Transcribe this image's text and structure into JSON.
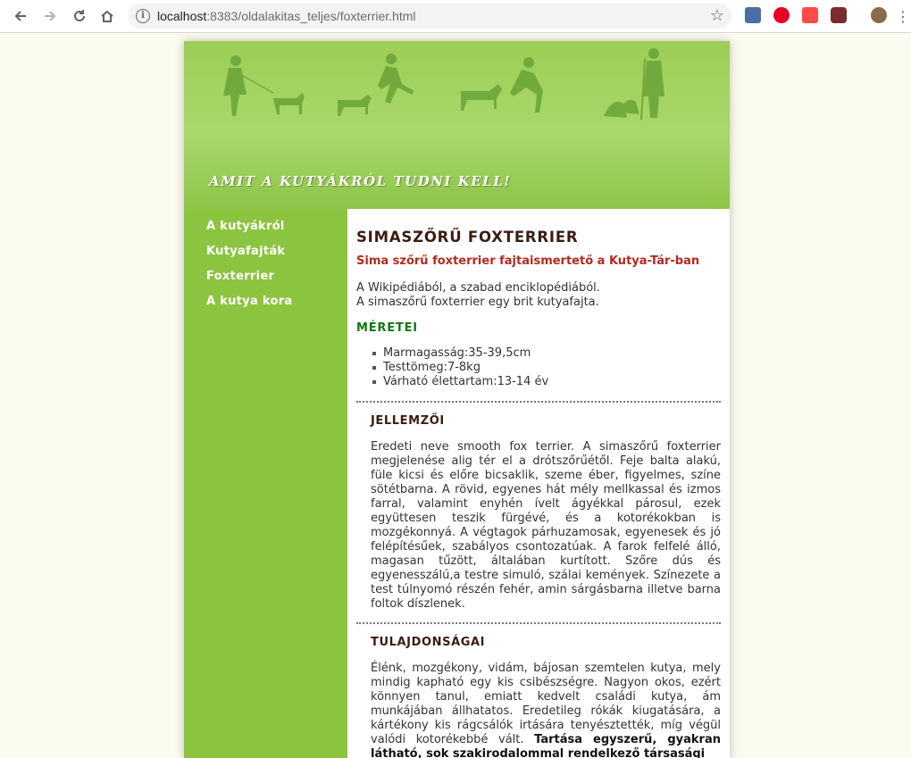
{
  "browser": {
    "url_host": "localhost",
    "url_rest": ":8383/oldalakitas_teljes/foxterrier.html"
  },
  "banner": {
    "title": "AMIT A KUTYÁKRÓL TUDNI KELL!"
  },
  "sidebar": {
    "items": [
      {
        "label": "A kutyákról"
      },
      {
        "label": "Kutyafajták"
      },
      {
        "label": "Foxterrier"
      },
      {
        "label": "A kutya kora"
      }
    ]
  },
  "content": {
    "title": "SIMASZŐRŰ FOXTERRIER",
    "subtitle": "Sima szőrű foxterrier fajtaismertető a Kutya-Tár-ban",
    "intro_line1": "A Wikipédiából, a szabad enciklopédiából.",
    "intro_line2": "A simaszőrű foxterrier egy brit kutyafajta.",
    "sizes_heading": "MÉRETEI",
    "sizes": [
      "Marmagasság:35-39,5cm",
      "Testtömeg:7-8kg",
      "Várható élettartam:13-14 év"
    ],
    "traits_heading": "JELLEMZŐI",
    "traits_text": "Eredeti neve smooth fox terrier. A simaszőrű foxterrier megjelenése alig tér el a drótszőrűétől. Feje balta alakú, füle kicsi és előre bicsaklik, szeme éber, figyelmes, színe sötétbarna. A rövid, egyenes hát mély mellkassal és izmos farral, valamint enyhén ívelt ágyékkal párosul, ezek együttesen teszik fürgévé, és a kotorékokban is mozgékonnyá. A végtagok párhuzamosak, egyenesek és jó felépítésűek, szabályos csontozatúak. A farok felfelé álló, magasan tűzött, általában kurtított. Szőre dús és egyenesszálú,a testre simuló, szálai kemények. Színezete a test túlnyomó részén fehér, amin sárgásbarna illetve barna foltok díszlenek.",
    "props_heading": "TULAJDONSÁGAI",
    "props_text": "Élénk, mozgékony, vidám, bájosan szemtelen kutya, mely mindig kapható egy kis csibészségre. Nagyon okos, ezért könnyen tanul, emiatt kedvelt családi kutya, ám munkájában állhatatos. Eredetileg rókák kiugatására, a kártékony kis rágcsálók irtására tenyésztették, míg végül valódi kotorékebbé vált.",
    "props_bold": "Tartása egyszerű, gyakran látható, sok szakirodalommal rendelkező társasági"
  },
  "colors": {
    "sidebar_bg": "#8bc53f",
    "title_brown": "#3b1c12",
    "subtitle_red": "#b22a1f",
    "heading_green": "#127713"
  }
}
